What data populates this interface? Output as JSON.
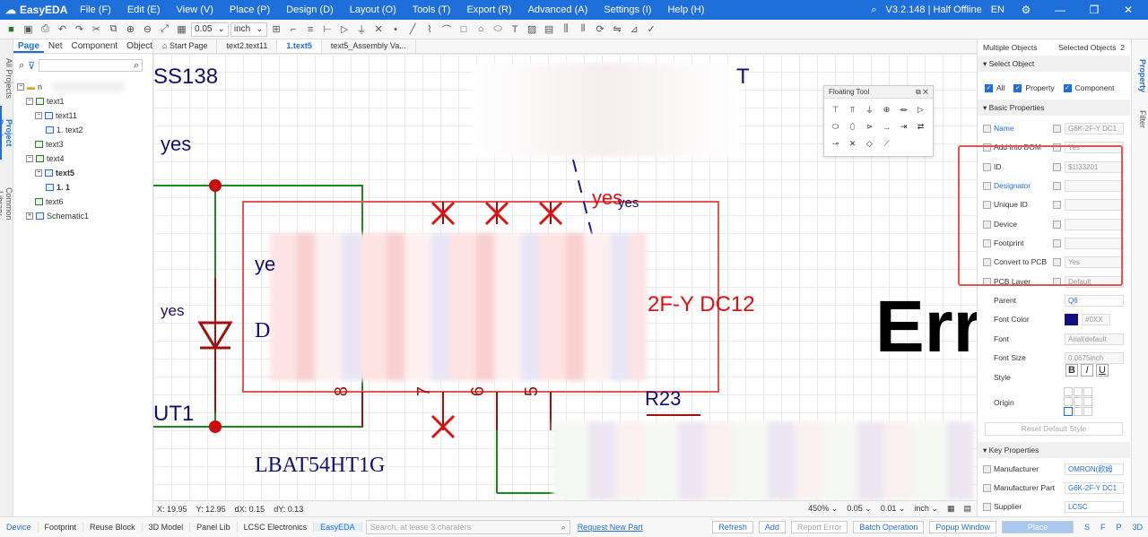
{
  "app": {
    "logo": "EasyEDA",
    "version": "V3.2.148 | Half Offline",
    "lang": "EN"
  },
  "menu": [
    "File (F)",
    "Edit (E)",
    "View (V)",
    "Place (P)",
    "Design (D)",
    "Layout (O)",
    "Tools (T)",
    "Export (R)",
    "Advanced (A)",
    "Settings (I)",
    "Help (H)"
  ],
  "toolbar": {
    "grid": "0.05",
    "unit": "inch"
  },
  "side_tabs": [
    "All Projects",
    "Project Design",
    "Common Library"
  ],
  "left_panel": {
    "tabs": [
      "Page",
      "Net",
      "Component",
      "Object"
    ],
    "tree": [
      {
        "label": "n",
        "icon": "folder"
      },
      {
        "label": "text1"
      },
      {
        "label": "text11"
      },
      {
        "label": "1. text2"
      },
      {
        "label": "text3"
      },
      {
        "label": "text4"
      },
      {
        "label": "text5"
      },
      {
        "label": "1. 1"
      },
      {
        "label": "text6"
      },
      {
        "label": "Schematic1"
      }
    ]
  },
  "doc_tabs": [
    "Start Page",
    "text2.text11",
    "1.text5",
    "text5_Assembly Va..."
  ],
  "canvas": {
    "labels": {
      "ss138": "SS138",
      "yes1": "yes",
      "yes2": "yes",
      "yes3": "yes",
      "yes4": "yes",
      "yes5": "ye",
      "d": "D",
      "t": "T",
      "part": "2F-Y DC12",
      "r23": "R23",
      "ut1": "UT1",
      "lbat": "LBAT54HT1G",
      "err": "Err",
      "pin8": "8",
      "pin7": "7",
      "pin6": "6",
      "pin5": "5"
    }
  },
  "floating_tool": {
    "title": "Floating Tool"
  },
  "status": {
    "x_label": "X:",
    "x": "19.95",
    "y_label": "Y:",
    "y": "12.95",
    "dx_label": "dX:",
    "dx": "0.15",
    "dy_label": "dY:",
    "dy": "0.13",
    "zoom": "450%",
    "grid": "0.05",
    "snap": "0.01",
    "unit": "inch"
  },
  "right_panel": {
    "header": "Multiple Objects",
    "selected_label": "Selected Objects",
    "selected_count": "2",
    "select_object": "Select Object",
    "chk_all": "All",
    "chk_property": "Property",
    "chk_component": "Component",
    "basic": "Basic Properties",
    "rows": [
      {
        "label": "Name",
        "value": "G6K-2F-Y DC1",
        "blue": true
      },
      {
        "label": "Add into BOM",
        "value": "Yes",
        "blue": false
      },
      {
        "label": "ID",
        "value": "$1I33201",
        "blue": false
      },
      {
        "label": "Designator",
        "value": "",
        "blue": true
      },
      {
        "label": "Unique ID",
        "value": "",
        "blue": false
      },
      {
        "label": "Device",
        "value": "",
        "blue": false
      },
      {
        "label": "Footprint",
        "value": "",
        "blue": false
      },
      {
        "label": "Convert to PCB",
        "value": "Yes",
        "blue": false
      },
      {
        "label": "PCB Layer",
        "value": "Default",
        "blue": false
      },
      {
        "label": "Parent",
        "value": "Q6",
        "blue": false
      },
      {
        "label": "Font Color",
        "value": "#0XX",
        "blue": false
      },
      {
        "label": "Font",
        "value": "Arial(default",
        "blue": false
      },
      {
        "label": "Font Size",
        "value": "0.0675inch",
        "blue": false
      },
      {
        "label": "Style",
        "value": "",
        "blue": false
      },
      {
        "label": "Origin",
        "value": "",
        "blue": false
      }
    ],
    "reset": "Reset Default Style",
    "key": "Key Properties",
    "key_rows": [
      {
        "label": "Manufacturer",
        "value": "OMRON(欧姆"
      },
      {
        "label": "Manufacturer Part",
        "value": "G6K-2F-Y DC1"
      },
      {
        "label": "Supplier",
        "value": "LCSC"
      }
    ],
    "vtabs": [
      "Property",
      "Filter"
    ]
  },
  "bottom": {
    "tabs": [
      "Device",
      "Footprint",
      "Reuse Block",
      "3D Model",
      "Panel Lib",
      "LCSC Electronics",
      "EasyEDA"
    ],
    "search_placeholder": "Search, at lease 3 charaters",
    "request": "Request New Part",
    "refresh": "Refresh",
    "add": "Add",
    "report": "Report Error",
    "batch": "Batch Operation",
    "popup": "Popup Window",
    "place": "Place",
    "modes": [
      "S",
      "F",
      "P",
      "3D"
    ]
  }
}
